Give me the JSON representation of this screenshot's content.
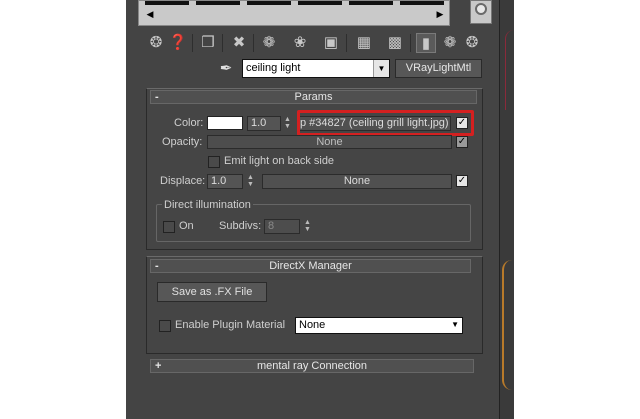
{
  "toolbar": {
    "icons": [
      "get-material-icon",
      "put-to-scene-icon",
      "assign-to-selection-icon",
      "reset-map-icon",
      "make-unique-icon",
      "put-to-library-icon",
      "material-id-channel-icon",
      "show-map-in-viewport-icon",
      "show-end-result-icon",
      "go-to-parent-icon",
      "go-forward-to-sibling-icon"
    ]
  },
  "material": {
    "name": "ceiling light",
    "type_button": "VRayLightMtl"
  },
  "params": {
    "title": "Params",
    "toggle": "-",
    "color_label": "Color:",
    "color_value": "#ffffff",
    "multiplier": "1.0",
    "color_map": "p #34827 (ceiling grill light.jpg)",
    "opacity_label": "Opacity:",
    "opacity_map": "None",
    "emit_back_label": "Emit light on back side",
    "displace_label": "Displace:",
    "displace_value": "1.0",
    "displace_map": "None",
    "direct_title": "Direct illumination",
    "on_label": "On",
    "subdivs_label": "Subdivs:",
    "subdivs_value": "8"
  },
  "directx": {
    "title": "DirectX Manager",
    "toggle": "-",
    "save_fx_label": "Save as .FX File",
    "enable_plugin_label": "Enable Plugin Material",
    "plugin_value": "None"
  },
  "mentalray": {
    "title": "mental ray Connection",
    "toggle": "+"
  },
  "colors": {
    "panel_bg": "#444444",
    "highlight": "#d42020"
  }
}
